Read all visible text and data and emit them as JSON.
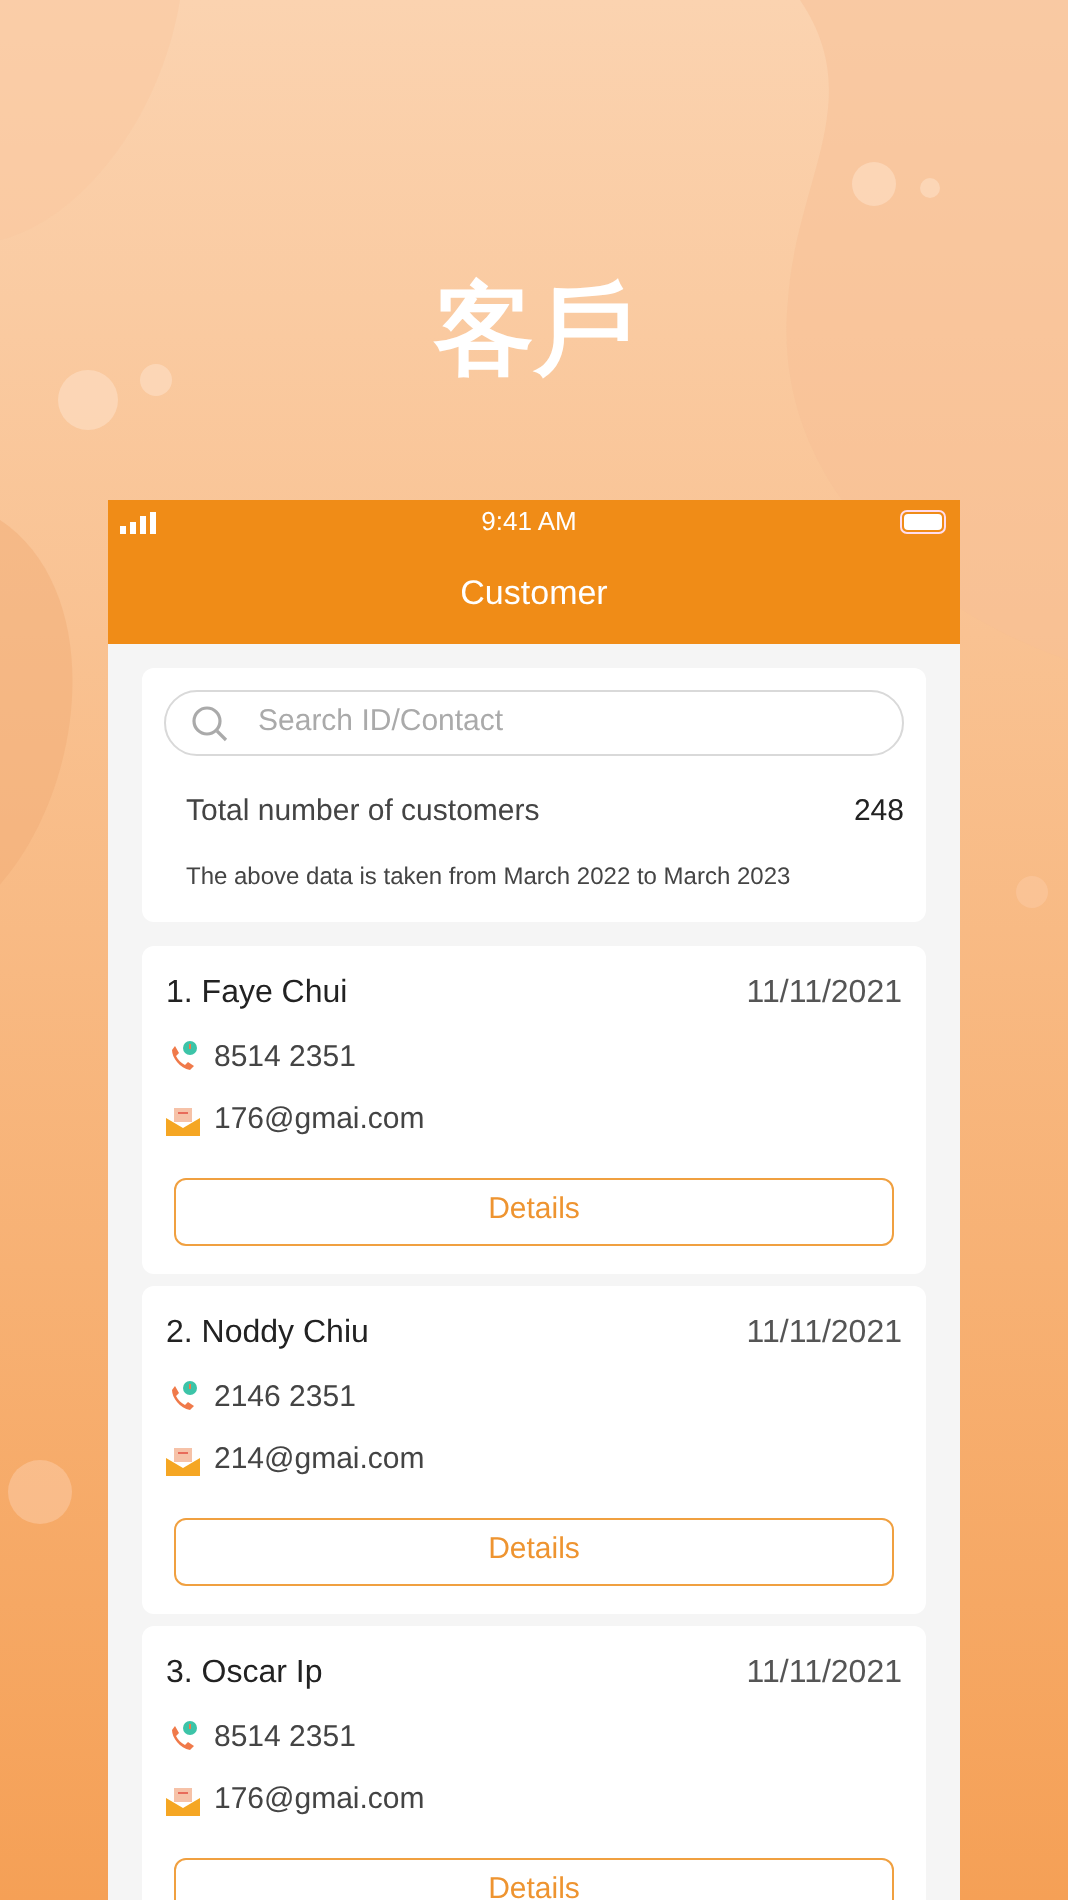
{
  "page_title": "客戶",
  "status_bar": {
    "time": "9:41 AM"
  },
  "header": {
    "title": "Customer"
  },
  "search": {
    "placeholder": "Search ID/Contact"
  },
  "summary": {
    "label": "Total number of customers",
    "value": "248",
    "note": "The above data is taken from March 2022 to March 2023"
  },
  "customers": [
    {
      "name": "1. Faye Chui",
      "date": "11/11/2021",
      "phone": "8514 2351",
      "email": "176@gmai.com",
      "button": "Details"
    },
    {
      "name": "2. Noddy Chiu",
      "date": "11/11/2021",
      "phone": "2146 2351",
      "email": "214@gmai.com",
      "button": "Details"
    },
    {
      "name": "3. Oscar Ip",
      "date": "11/11/2021",
      "phone": "8514 2351",
      "email": "176@gmai.com",
      "button": "Details"
    }
  ]
}
